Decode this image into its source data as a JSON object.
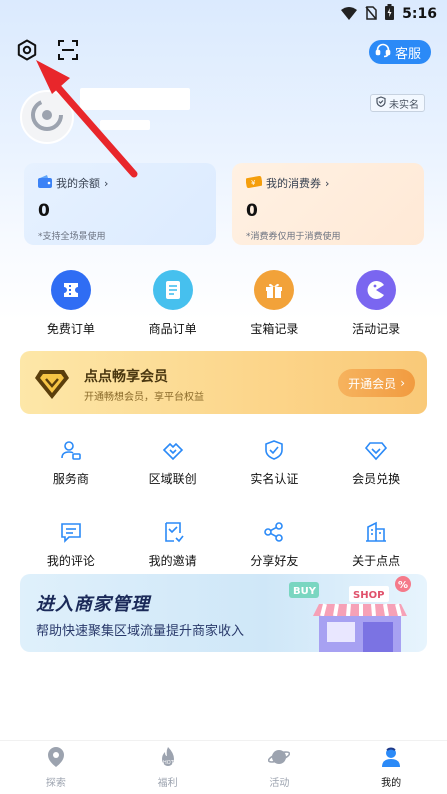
{
  "status_bar": {
    "time": "5:16"
  },
  "header": {
    "service_label": "客服"
  },
  "profile": {
    "badge_label": "未实名"
  },
  "wallet": {
    "balance": {
      "title": "我的余额",
      "value": "0",
      "note": "*支持全场景使用"
    },
    "coupon": {
      "title": "我的消费券",
      "value": "0",
      "note": "*消费券仅用于消费使用"
    }
  },
  "quick_actions": [
    {
      "label": "免费订单",
      "color": "#2f6df4",
      "icon": "ticket-icon"
    },
    {
      "label": "商品订单",
      "color": "#46c0ee",
      "icon": "order-list-icon"
    },
    {
      "label": "宝箱记录",
      "color": "#f2a239",
      "icon": "gift-box-icon"
    },
    {
      "label": "活动记录",
      "color": "#7a66f0",
      "icon": "pacman-icon"
    }
  ],
  "vip": {
    "title": "点点畅享会员",
    "subtitle": "开通畅想会员，享平台权益",
    "button": "开通会员"
  },
  "services": [
    {
      "label": "服务商",
      "icon": "person-card-icon"
    },
    {
      "label": "区域联创",
      "icon": "handshake-icon"
    },
    {
      "label": "实名认证",
      "icon": "shield-check-icon"
    },
    {
      "label": "会员兑换",
      "icon": "diamond-icon"
    },
    {
      "label": "我的评论",
      "icon": "comment-icon"
    },
    {
      "label": "我的邀请",
      "icon": "invite-icon"
    },
    {
      "label": "分享好友",
      "icon": "share-icon"
    },
    {
      "label": "关于点点",
      "icon": "building-icon"
    }
  ],
  "merchant_banner": {
    "title": "进入商家管理",
    "subtitle": "帮助快速聚集区域流量提升商家收入",
    "art_buy": "BUY",
    "art_shop": "SHOP",
    "art_badge": "%"
  },
  "tabs": [
    {
      "label": "探索",
      "icon": "location-pin-icon",
      "active": false
    },
    {
      "label": "福利",
      "icon": "hot-flame-icon",
      "active": false
    },
    {
      "label": "活动",
      "icon": "planet-icon",
      "active": false
    },
    {
      "label": "我的",
      "icon": "profile-icon",
      "active": true
    }
  ],
  "colors": {
    "accent": "#2b8af7",
    "annotation_arrow": "#e8262b"
  }
}
